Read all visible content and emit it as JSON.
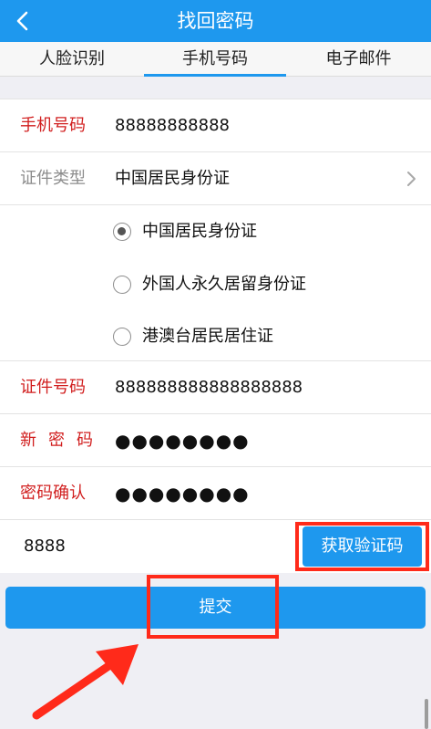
{
  "header": {
    "title": "找回密码",
    "back_icon": "back-arrow-icon"
  },
  "tabs": [
    {
      "label": "人脸识别"
    },
    {
      "label": "手机号码",
      "active": true
    },
    {
      "label": "电子邮件"
    }
  ],
  "form": {
    "phone": {
      "label": "手机号码",
      "value": "88888888888"
    },
    "id_type": {
      "label": "证件类型",
      "value": "中国居民身份证"
    },
    "id_options": [
      {
        "label": "中国居民身份证",
        "checked": true
      },
      {
        "label": "外国人永久居留身份证",
        "checked": false
      },
      {
        "label": "港澳台居民居住证",
        "checked": false
      }
    ],
    "id_number": {
      "label": "证件号码",
      "value": "888888888888888888"
    },
    "new_password": {
      "label": "新密码",
      "value": "●●●●●●●●"
    },
    "confirm_password": {
      "label": "密码确认",
      "value": "●●●●●●●●"
    },
    "verify_code": {
      "value": "8888",
      "button_label": "获取验证码"
    }
  },
  "submit": {
    "label": "提交"
  },
  "colors": {
    "primary": "#1e98ee",
    "label_red": "#d11e1e",
    "highlight_red": "#ff2a1a",
    "background": "#efeff4"
  }
}
